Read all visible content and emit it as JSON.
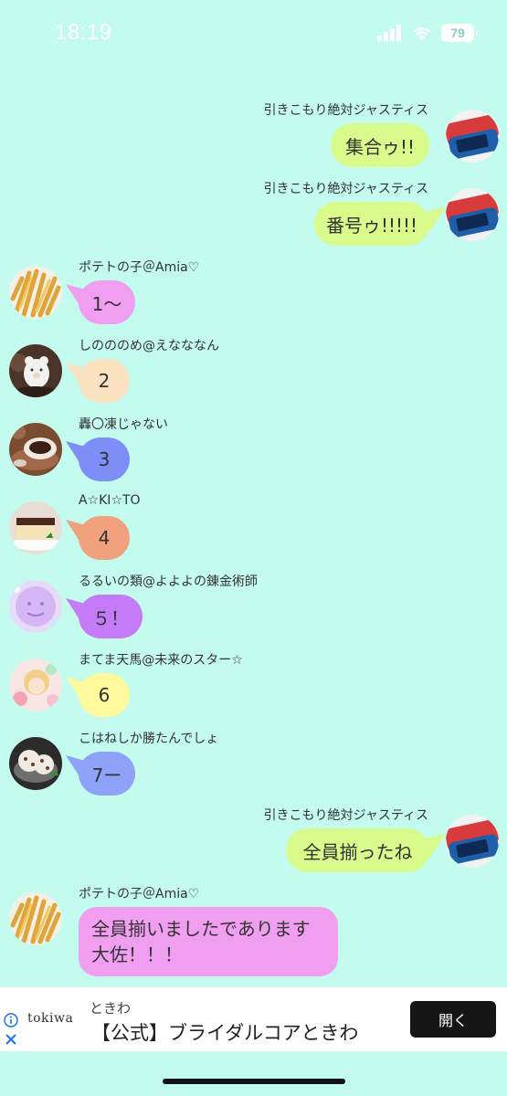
{
  "status": {
    "time": "18:19",
    "battery": "79"
  },
  "messages": [
    {
      "sender": "引きこもり絶対ジャスティス",
      "text": "集合ゥ!!",
      "side": "right"
    },
    {
      "sender": "引きこもり絶対ジャスティス",
      "text": "番号ゥ!!!!!",
      "side": "right"
    },
    {
      "sender": "ポテトの子＠Amia♡",
      "text": "1〜",
      "side": "left"
    },
    {
      "sender": "しのののめ@えなななん",
      "text": "2",
      "side": "left"
    },
    {
      "sender": "轟〇凍じゃない",
      "text": "3",
      "side": "left"
    },
    {
      "sender": "A☆KI☆TO",
      "text": "4",
      "side": "left"
    },
    {
      "sender": "るるいの類@よよよの錬金術師",
      "text": "５！",
      "side": "left"
    },
    {
      "sender": "まてま天馬@未来のスター☆",
      "text": "6",
      "side": "left"
    },
    {
      "sender": "こはねしか勝たんでしょ",
      "text": "7ー",
      "side": "left"
    },
    {
      "sender": "引きこもり絶対ジャスティス",
      "text": "全員揃ったね",
      "side": "right"
    },
    {
      "sender": "ポテトの子＠Amia♡",
      "text": "全員揃いましたであります大佐！！！",
      "side": "left"
    }
  ],
  "colors": {
    "background": "#c3fbee",
    "right_bubble": "#d9fb8b",
    "bubble_1": "#f09ff0",
    "bubble_2": "#fbe2c0",
    "bubble_3": "#7e8ef7",
    "bubble_4": "#f2a17f",
    "bubble_5": "#c57bf7",
    "bubble_6": "#fdf99c",
    "bubble_7": "#8ea3f7"
  },
  "ad": {
    "logo": "tokiwa",
    "subtitle": "ときわ",
    "title": "【公式】ブライダルコアときわ",
    "button": "開く"
  }
}
